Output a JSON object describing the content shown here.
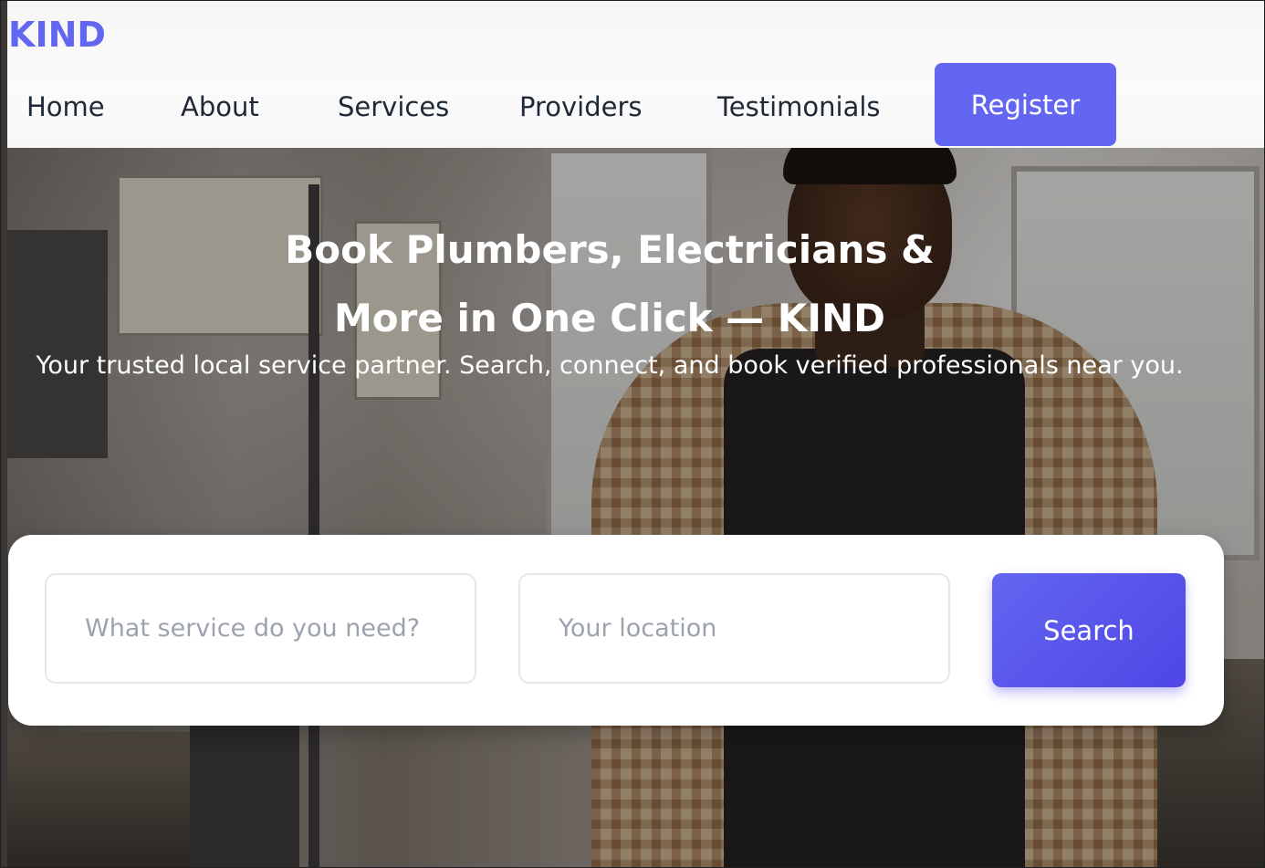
{
  "brand": {
    "logo_text": "KIND",
    "accent_color": "#6366f1"
  },
  "nav": {
    "items": [
      {
        "label": "Home"
      },
      {
        "label": "About"
      },
      {
        "label": "Services"
      },
      {
        "label": "Providers"
      },
      {
        "label": "Testimonials"
      }
    ],
    "register_label": "Register"
  },
  "hero": {
    "title_line1": "Book Plumbers, Electricians &",
    "title_line2": "More in One Click — KIND",
    "subtitle": "Your trusted local service partner. Search, connect, and book verified professionals near you."
  },
  "search": {
    "service_placeholder": "What service do you need?",
    "location_placeholder": "Your location",
    "button_label": "Search"
  }
}
